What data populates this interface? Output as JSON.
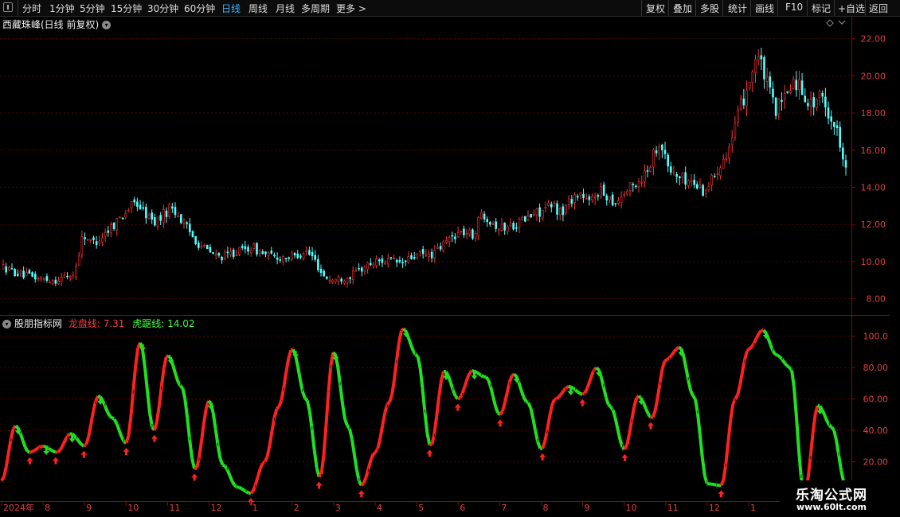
{
  "toolbar": {
    "left": [
      "分时",
      "1分钟",
      "5分钟",
      "15分钟",
      "30分钟",
      "60分钟",
      "日线",
      "周线",
      "月线",
      "多周期",
      "更多 >"
    ],
    "active": "日线",
    "right": [
      "复权",
      "叠加",
      "多股",
      "统计",
      "画线",
      "F10",
      "标记",
      "+自选",
      "返回"
    ]
  },
  "price_panel": {
    "title": "西藏珠峰(日线 前复权)"
  },
  "indicator_panel": {
    "name": "股朋指标网",
    "line1_label": "龙盘线: 7.31",
    "line2_label": "虎踞线: 14.02"
  },
  "date_axis": [
    "2024年",
    "8",
    "9",
    "10",
    "11",
    "12",
    "1",
    "2",
    "3",
    "4",
    "5",
    "6",
    "7",
    "8",
    "9",
    "10",
    "11",
    "12",
    "1"
  ],
  "watermark": {
    "line1": "乐淘公式网",
    "line2": "www.60lt.com"
  },
  "colors": {
    "up": "#ff3232",
    "down": "#54ffff",
    "osc_up": "#ff2020",
    "osc_down": "#20e020",
    "grid": "#5a0000",
    "axis": "#7a0a0a",
    "active": "#3bb3ff"
  },
  "chart_data": [
    {
      "type": "candlestick",
      "title": "西藏珠峰(日线 前复权)",
      "y_ticks": [
        "22.00",
        "20.00",
        "18.00",
        "16.00",
        "14.00",
        "12.00",
        "10.00",
        "8.00"
      ],
      "ylim": [
        7.3,
        22.8
      ],
      "close_series": [
        9.7,
        9.5,
        9.3,
        9.2,
        9.1,
        9.05,
        9.0,
        9.2,
        9.3,
        11.5,
        11.0,
        11.3,
        11.8,
        12.3,
        12.8,
        13.2,
        12.6,
        12.1,
        12.5,
        13.0,
        12.3,
        11.6,
        11.0,
        10.6,
        10.3,
        10.3,
        10.5,
        10.6,
        10.8,
        10.5,
        10.3,
        10.2,
        10.3,
        10.3,
        10.6,
        10.2,
        9.3,
        9.0,
        9.1,
        9.2,
        9.5,
        9.8,
        10.0,
        10.1,
        10.0,
        9.9,
        10.2,
        10.4,
        10.3,
        10.6,
        11.1,
        11.5,
        11.6,
        11.4,
        12.7,
        12.2,
        11.8,
        11.9,
        12.1,
        12.3,
        12.6,
        12.8,
        13.0,
        12.6,
        13.4,
        13.7,
        13.1,
        13.8,
        13.6,
        13.2,
        13.7,
        14.1,
        14.5,
        15.4,
        16.6,
        15.0,
        14.6,
        14.4,
        14.2,
        13.8,
        14.5,
        15.5,
        16.3,
        18.1,
        19.6,
        21.2,
        19.7,
        18.2,
        18.6,
        19.8,
        19.4,
        18.4,
        18.9,
        18.1,
        17.0,
        15.3
      ]
    },
    {
      "type": "line",
      "series": [
        {
          "name": "龙盘线",
          "color": "#ff2020"
        },
        {
          "name": "虎踞线",
          "color": "#20e020"
        }
      ],
      "y_ticks": [
        "100.0",
        "80.00",
        "60.00",
        "40.00",
        "20.00"
      ],
      "ylim": [
        -4,
        110
      ],
      "values": [
        8,
        43,
        26,
        30,
        26,
        38,
        30,
        62,
        48,
        32,
        96,
        40,
        88,
        68,
        15,
        59,
        18,
        4,
        0,
        20,
        55,
        92,
        60,
        10,
        90,
        43,
        5,
        26,
        58,
        105,
        88,
        30,
        78,
        60,
        78,
        74,
        50,
        76,
        58,
        28,
        60,
        68,
        63,
        80,
        55,
        28,
        62,
        48,
        85,
        93,
        62,
        6,
        5,
        60,
        92,
        104,
        88,
        80,
        0,
        56,
        42,
        5
      ]
    }
  ]
}
